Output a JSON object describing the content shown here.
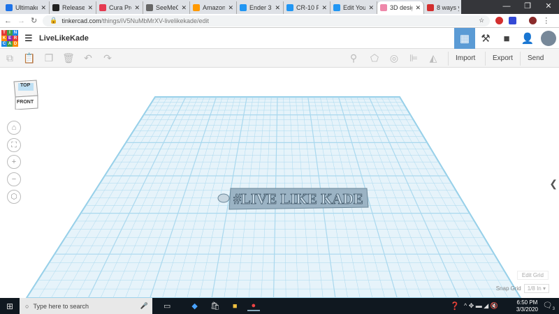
{
  "browser": {
    "tabs": [
      {
        "label": "Ultimaker",
        "color": "#1e73e8"
      },
      {
        "label": "Release ·",
        "color": "#222"
      },
      {
        "label": "Cura Pro",
        "color": "#e53950"
      },
      {
        "label": "SeeMeCl",
        "color": "#666"
      },
      {
        "label": "Amazon.",
        "color": "#f90"
      },
      {
        "label": "Ender 3",
        "color": "#2196f3"
      },
      {
        "label": "CR-10 Fi",
        "color": "#2196f3"
      },
      {
        "label": "Edit Your",
        "color": "#2196f3"
      },
      {
        "label": "3D desig",
        "color": "#e8a",
        "active": true
      },
      {
        "label": "8 ways y",
        "color": "#d32f2f"
      }
    ],
    "new_tab": "+",
    "url_host": "tinkercad.com",
    "url_path": "/things/iV5NuMbMrXV-livelikekade/edit"
  },
  "app": {
    "logo": [
      "TIN",
      "KER",
      "CAD"
    ],
    "design_title": "LiveLikeKade",
    "toolbar": {
      "import": "Import",
      "export": "Export",
      "send_to": "Send To"
    },
    "view_cube": {
      "top": "TOP",
      "front": "FRONT"
    },
    "object_text": "#LIVE LIKE KADE",
    "edit_grid": "Edit Grid",
    "snap_grid_label": "Snap Grid",
    "snap_grid_value": "1/8 In"
  },
  "taskbar": {
    "search_placeholder": "Type here to search",
    "time": "6:50 PM",
    "date": "3/3/2020",
    "notifications": "3"
  }
}
